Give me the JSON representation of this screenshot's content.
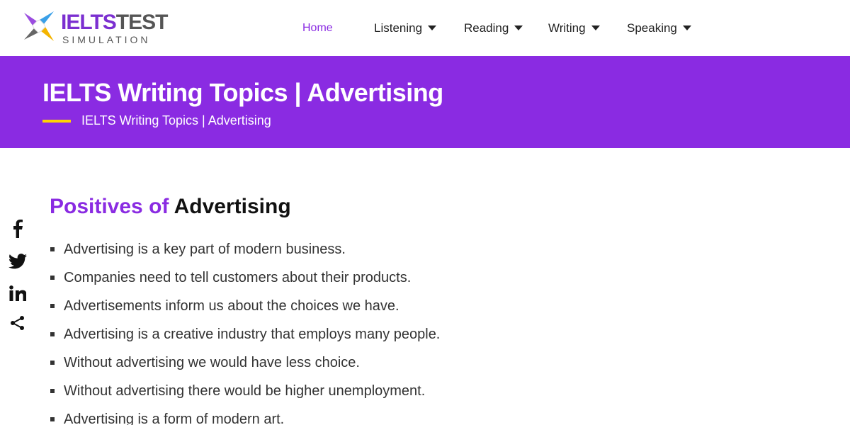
{
  "logo": {
    "title_part1": "IELTS",
    "title_part2": "TEST",
    "subtitle": "SIMULATION"
  },
  "nav": {
    "items": [
      {
        "label": "Home",
        "active": true,
        "dropdown": false
      },
      {
        "label": "Listening",
        "active": false,
        "dropdown": true
      },
      {
        "label": "Reading",
        "active": false,
        "dropdown": true
      },
      {
        "label": "Writing",
        "active": false,
        "dropdown": true
      },
      {
        "label": "Speaking",
        "active": false,
        "dropdown": true
      }
    ]
  },
  "banner": {
    "title": "IELTS Writing Topics | Advertising",
    "breadcrumb": "IELTS Writing Topics | Advertising"
  },
  "social": {
    "icons": [
      "facebook-icon",
      "twitter-icon",
      "linkedin-icon",
      "share-icon"
    ]
  },
  "content": {
    "heading_part1": "Positives of ",
    "heading_part2": "Advertising",
    "items": [
      "Advertising is a key part of modern business.",
      "Companies need to tell customers about their products.",
      "Advertisements inform us about the choices we have.",
      "Advertising is a creative industry that employs many people.",
      "Without advertising we would have less choice.",
      "Without advertising there would be higher unemployment.",
      "Advertising is a form of modern art."
    ]
  },
  "colors": {
    "brand_purple": "#8a2be2",
    "accent_yellow": "#ffd400"
  }
}
